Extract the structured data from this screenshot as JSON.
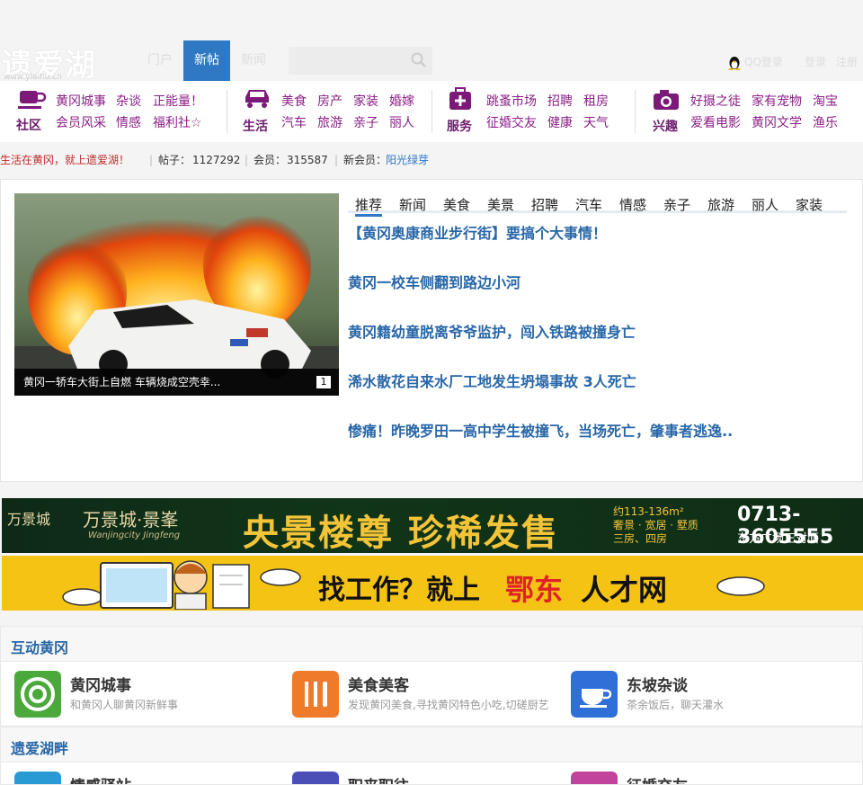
{
  "header": {
    "logo_text": "遗爱湖",
    "logo_url_text": "www.yiaihu.cn",
    "nav": [
      "门户",
      "新帖",
      "新闻"
    ],
    "active_nav": "新帖",
    "search_placeholder": "",
    "qq_login": "QQ登录",
    "login": "登录",
    "register": "注册"
  },
  "categories": [
    {
      "title": "社区",
      "icon": "coffee-cup-icon",
      "links": [
        "黄冈城事",
        "杂谈",
        "正能量！",
        "会员风采",
        "情感",
        "福利社☆"
      ]
    },
    {
      "title": "生活",
      "icon": "car-icon",
      "links": [
        "美食",
        "房产",
        "家装",
        "婚嫁",
        "汽车",
        "旅游",
        "亲子",
        "丽人"
      ]
    },
    {
      "title": "服务",
      "icon": "medical-kit-icon",
      "links": [
        "跳蚤市场",
        "招聘",
        "租房",
        "征婚交友",
        "健康",
        "天气"
      ]
    },
    {
      "title": "兴趣",
      "icon": "camera-icon",
      "links": [
        "好摄之徒",
        "家有宠物",
        "淘宝",
        "爱看电影",
        "黄冈文学",
        "渔乐"
      ]
    }
  ],
  "stats": {
    "slogan": "生活在黄冈，就上遗爱湖！",
    "posts_label": "帖子：",
    "posts": "1127292",
    "members_label": "会员：",
    "members": "315587",
    "new_member_label": "新会员：",
    "new_member": "阳光绿芽",
    "divider": "|"
  },
  "feature": {
    "caption": "黄冈一轿车大街上自燃 车辆烧成空壳幸...",
    "slide_index": "1",
    "tabs": [
      "推荐",
      "新闻",
      "美食",
      "美景",
      "招聘",
      "汽车",
      "情感",
      "亲子",
      "旅游",
      "丽人",
      "家装"
    ],
    "active_tab": "推荐",
    "headlines": [
      "【黄冈奥康商业步行街】要搞个大事情！",
      "黄冈一校车侧翻到路边小河",
      "黄冈籍幼童脱离爷爷监护，闯入铁路被撞身亡",
      "浠水散花自来水厂工地发生坍塌事故 3人死亡",
      "惨痛！昨晚罗田一高中学生被撞飞，当场死亡，肇事者逃逸.."
    ]
  },
  "banners": {
    "b1_brand": "万景城",
    "b1_brand2": "万景城·景峯",
    "b1_brand_en": "Wanjingcity Jingfeng",
    "b1_main": "央景楼尊 珍稀发售",
    "b1_info": [
      "约113-136m²",
      "奢景 · 宽居 · 墅质",
      "三房、四房"
    ],
    "b1_phone": "0713-3605555",
    "b1_addr": "东方广场正对面",
    "b2_text1": "找工作？就上",
    "b2_text2": "鄂东",
    "b2_text3": "人才网"
  },
  "sections": [
    {
      "title": "互动黄冈",
      "forums": [
        {
          "name": "黄冈城事",
          "desc": "和黄冈人聊黄冈新鲜事",
          "icon": "target-icon",
          "color": "#4aa93a"
        },
        {
          "name": "美食美客",
          "desc": "发现黄冈美食,寻找黄冈特色小吃,切磋厨艺",
          "icon": "fork-knife-icon",
          "color": "#ef7a2a"
        },
        {
          "name": "东坡杂谈",
          "desc": "茶余饭后，聊天灌水",
          "icon": "teacup-icon",
          "color": "#2f6fd8"
        }
      ]
    },
    {
      "title": "遗爱湖畔",
      "forums": [
        {
          "name": "情感驿站",
          "desc": "",
          "icon": "chat-icon",
          "color": "#2a9ad4"
        },
        {
          "name": "职来职往",
          "desc": "",
          "icon": "briefcase-icon",
          "color": "#4a4fb8"
        },
        {
          "name": "征婚交友",
          "desc": "",
          "icon": "people-icon",
          "color": "#c2449a"
        }
      ]
    }
  ]
}
